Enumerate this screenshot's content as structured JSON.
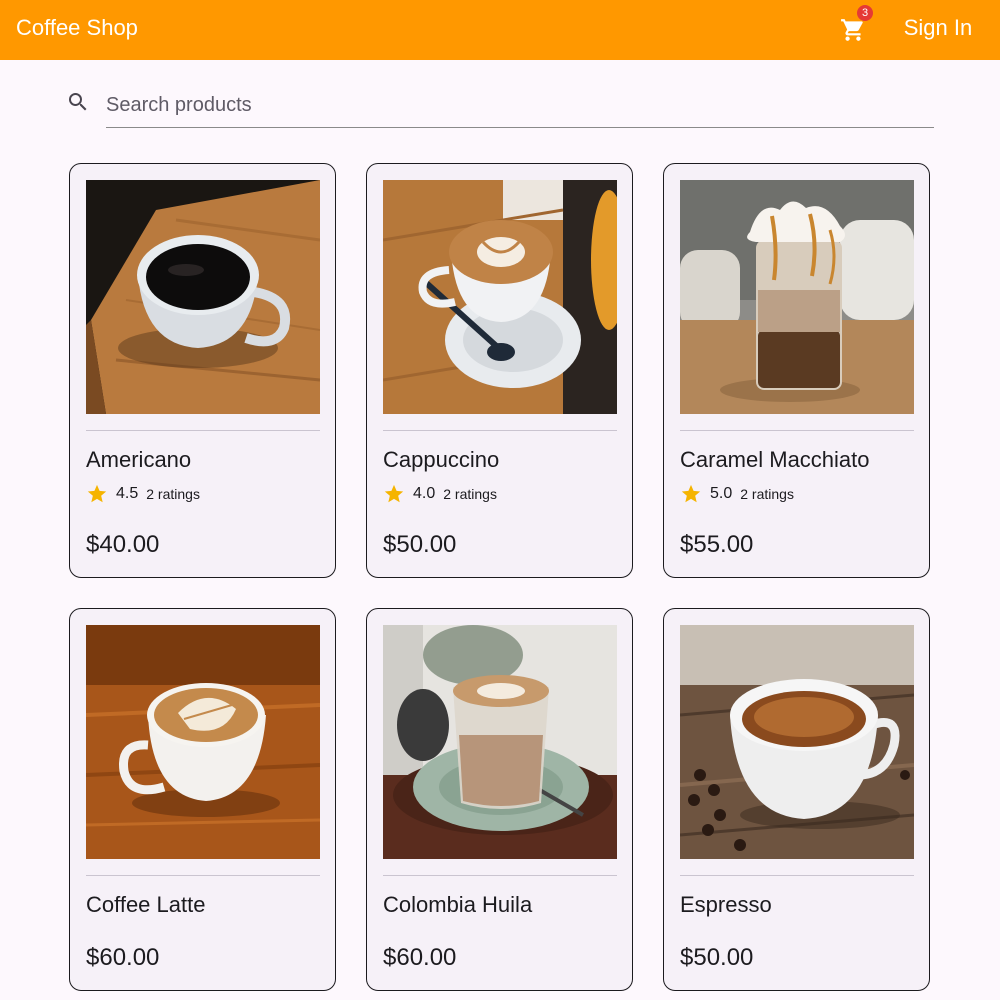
{
  "appbar": {
    "title": "Coffee Shop",
    "cart_count": "3",
    "cart_icon": "shopping-cart-icon",
    "sign_in_label": "Sign In",
    "color": "#ff9800"
  },
  "search": {
    "placeholder": "Search products",
    "value": "",
    "icon": "search-icon"
  },
  "products": [
    {
      "name": "Americano",
      "rating": "4.5",
      "ratings_count": "2 ratings",
      "price": "$40.00",
      "image": "black-coffee-cup-on-wooden-board"
    },
    {
      "name": "Cappuccino",
      "rating": "4.0",
      "ratings_count": "2 ratings",
      "price": "$50.00",
      "image": "cappuccino-latte-art-cup-with-saucer"
    },
    {
      "name": "Caramel Macchiato",
      "rating": "5.0",
      "ratings_count": "2 ratings",
      "price": "$55.00",
      "image": "iced-caramel-macchiato-jar-with-cream"
    },
    {
      "name": "Coffee Latte",
      "price": "$60.00",
      "image": "latte-art-cup-on-wooden-table"
    },
    {
      "name": "Colombia Huila",
      "price": "$60.00",
      "image": "latte-glass-on-green-saucer"
    },
    {
      "name": "Espresso",
      "price": "$50.00",
      "image": "espresso-cup-with-coffee-beans"
    }
  ],
  "colors": {
    "star": "#f5b400",
    "card_border": "#1c1b1f",
    "card_background": "#f6f1f8",
    "badge": "#e53935"
  }
}
